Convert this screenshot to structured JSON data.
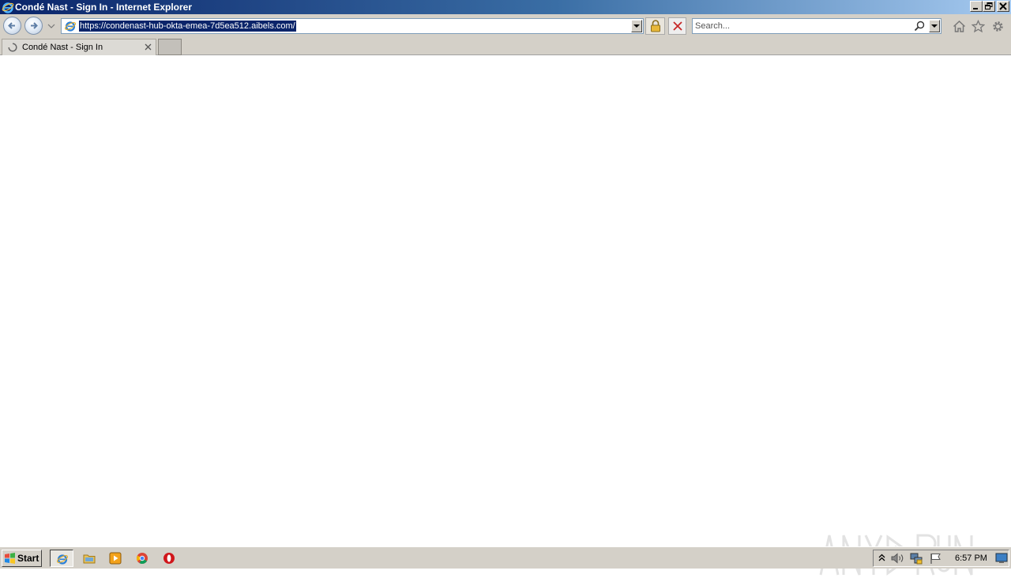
{
  "window": {
    "title": "Condé Nast - Sign In - Internet Explorer"
  },
  "address_bar": {
    "url": "https://condenast-hub-okta-emea-7d5ea512.aibels.com/"
  },
  "search": {
    "placeholder": "Search..."
  },
  "tabs": [
    {
      "label": "Condé Nast - Sign In",
      "loading": true
    }
  ],
  "watermark": {
    "text_left": "ANY",
    "text_right": "RUN"
  },
  "taskbar": {
    "start_label": "Start",
    "quick_launch": [
      "internet-explorer-icon",
      "folder-icon",
      "media-player-icon",
      "chrome-icon",
      "opera-icon"
    ],
    "clock": "6:57 PM"
  },
  "colors": {
    "titlebar_start": "#0a246a",
    "titlebar_end": "#a6caf0",
    "chrome_gray": "#d4d0c8",
    "url_highlight": "#0a246a"
  }
}
